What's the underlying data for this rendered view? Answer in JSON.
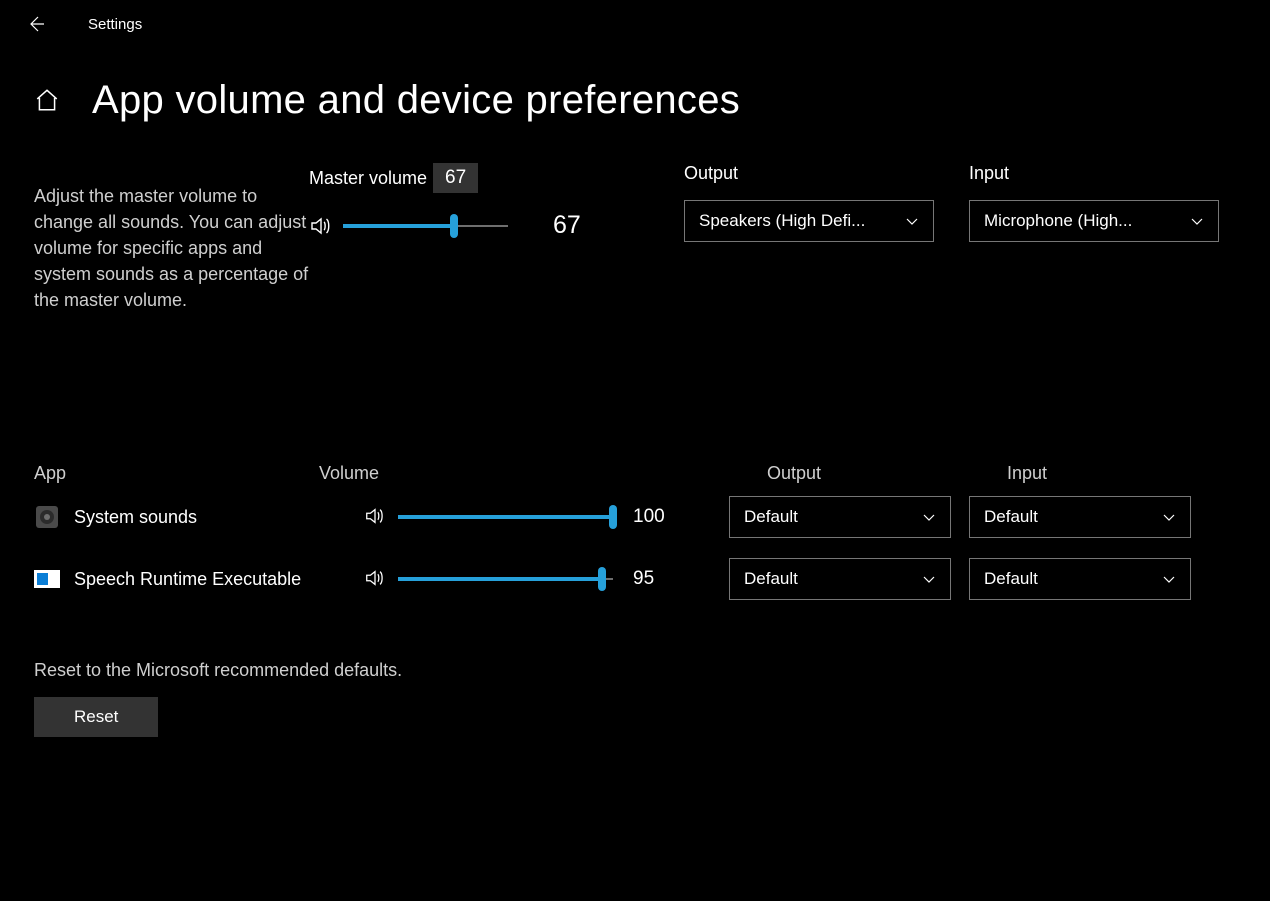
{
  "window": {
    "app_name": "Settings"
  },
  "header": {
    "title": "App volume and device preferences"
  },
  "master": {
    "description": "Adjust the master volume to change all sounds. You can adjust volume for specific apps and system sounds as a percentage of the master volume.",
    "label": "Master volume",
    "tooltip_value": "67",
    "value": 67,
    "value_display": "67",
    "output_label": "Output",
    "output_selected": "Speakers (High Defi...",
    "input_label": "Input",
    "input_selected": "Microphone (High..."
  },
  "app_section": {
    "headers": {
      "app": "App",
      "volume": "Volume",
      "output": "Output",
      "input": "Input"
    },
    "rows": [
      {
        "name": "System sounds",
        "value": 100,
        "value_display": "100",
        "output_selected": "Default",
        "input_selected": "Default",
        "icon": "system-sounds"
      },
      {
        "name": "Speech Runtime Executable",
        "value": 95,
        "value_display": "95",
        "output_selected": "Default",
        "input_selected": "Default",
        "icon": "speech-runtime"
      }
    ]
  },
  "reset": {
    "description": "Reset to the Microsoft recommended defaults.",
    "button_label": "Reset"
  },
  "colors": {
    "accent": "#26a0da",
    "border": "#767676"
  }
}
